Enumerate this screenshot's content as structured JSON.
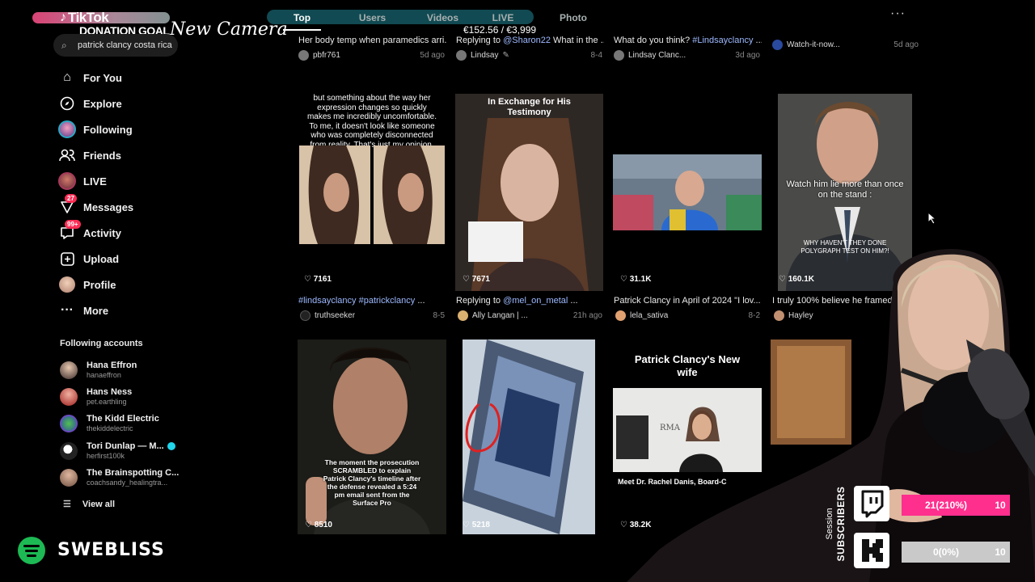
{
  "tabs": [
    "Top",
    "Users",
    "Videos",
    "LIVE",
    "Photo"
  ],
  "overlay": {
    "app_name": "TikTok",
    "donation_label": "DONATION GOAL",
    "camera_label": "New Camera",
    "amount": "€152.56 / €3,999"
  },
  "search": {
    "value": "patrick clancy costa rica"
  },
  "nav": [
    {
      "label": "For You",
      "icon": "home-icon"
    },
    {
      "label": "Explore",
      "icon": "compass-icon"
    },
    {
      "label": "Following",
      "icon": "following-avatar"
    },
    {
      "label": "Friends",
      "icon": "friends-icon"
    },
    {
      "label": "LIVE",
      "icon": "live-icon"
    },
    {
      "label": "Messages",
      "icon": "messages-icon",
      "badge": "27"
    },
    {
      "label": "Activity",
      "icon": "activity-icon",
      "badge": "99+"
    },
    {
      "label": "Upload",
      "icon": "upload-icon"
    },
    {
      "label": "Profile",
      "icon": "profile-avatar"
    },
    {
      "label": "More",
      "icon": "more-icon"
    }
  ],
  "following": {
    "title": "Following accounts",
    "accounts": [
      {
        "name": "Hana Effron",
        "handle": "hanaeffron"
      },
      {
        "name": "Hans Ness",
        "handle": "pet.earthling"
      },
      {
        "name": "The Kidd Electric",
        "handle": "thekiddelectric"
      },
      {
        "name": "Tori Dunlap — M...",
        "handle": "herfirst100k"
      },
      {
        "name": "The Brainspotting C...",
        "handle": "coachsandy_healingtra..."
      }
    ],
    "view_all": "View all"
  },
  "spotify": {
    "name": "SWEBLISS"
  },
  "row0": [
    {
      "caption": "Her body temp when paramedics arri...",
      "author": "pbfr761",
      "date": "5d ago"
    },
    {
      "caption_prefix": "Replying to ",
      "mention": "@Sharon22",
      "caption_suffix": " What in the ...",
      "author": "Lindsay",
      "date": "8-4"
    },
    {
      "caption_prefix": "What do you think? ",
      "mention": "#Lindsayclancy",
      "caption_suffix": " ...",
      "author": "Lindsay Clanc...",
      "date": "3d ago"
    },
    {
      "caption": "",
      "author": "Watch-it-now...",
      "date": "5d ago"
    }
  ],
  "row1": [
    {
      "likes": "7161",
      "overlay": "but something about the way her expression changes so quickly makes me incredibly uncomfortable. To me, it doesn't look like someone who was completely disconnected from reality. That's just my opinion.",
      "caption_mention": "#lindsayclancy #patrickclancy",
      "caption_suffix": " ...",
      "author": "truthseeker",
      "date": "8-5"
    },
    {
      "likes": "7671",
      "overlay": "In Exchange for His Testimony",
      "caption_prefix": "Replying to ",
      "caption_mention": "@mel_on_metal",
      "caption_suffix": " ...",
      "author": "Ally Langan | ...",
      "date": "21h ago"
    },
    {
      "likes": "31.1K",
      "caption_prefix": "Patrick Clancy in April of 2024 \"I lov...",
      "author": "lela_sativa",
      "date": "8-2"
    },
    {
      "likes": "160.1K",
      "overlay": "Watch him lie more than once on the stand :",
      "overlay2": "WHY HAVEN'T THEY DONE POLYGRAPH TEST ON HIM?!",
      "caption_prefix": "I truly 100% believe he framed l",
      "author": "Hayley",
      "date": ""
    }
  ],
  "row2": [
    {
      "likes": "8510",
      "overlay": "The moment the prosecution SCRAMBLED to explain Patrick Clancy's timeline after the defense revealed a 5:24 pm email sent from the Surface Pro"
    },
    {
      "likes": "5218"
    },
    {
      "likes": "38.2K",
      "overlay": "Patrick Clancy's New wife",
      "overlay2": "Meet Dr. Rachel Danis, Board-C"
    },
    {
      "likes": ""
    }
  ],
  "stream": {
    "session_label": "Session",
    "subscribers_label": "SUBSCRIBERS",
    "twitch_progress": "21(210%)",
    "twitch_goal": "10",
    "twitch_fraction": 1.0,
    "kick_progress": "0(0%)",
    "kick_goal": "10",
    "kick_fraction": 0.0,
    "colors": {
      "twitch": "#ff2f8e",
      "kick_track": "#c9c9c9"
    }
  }
}
